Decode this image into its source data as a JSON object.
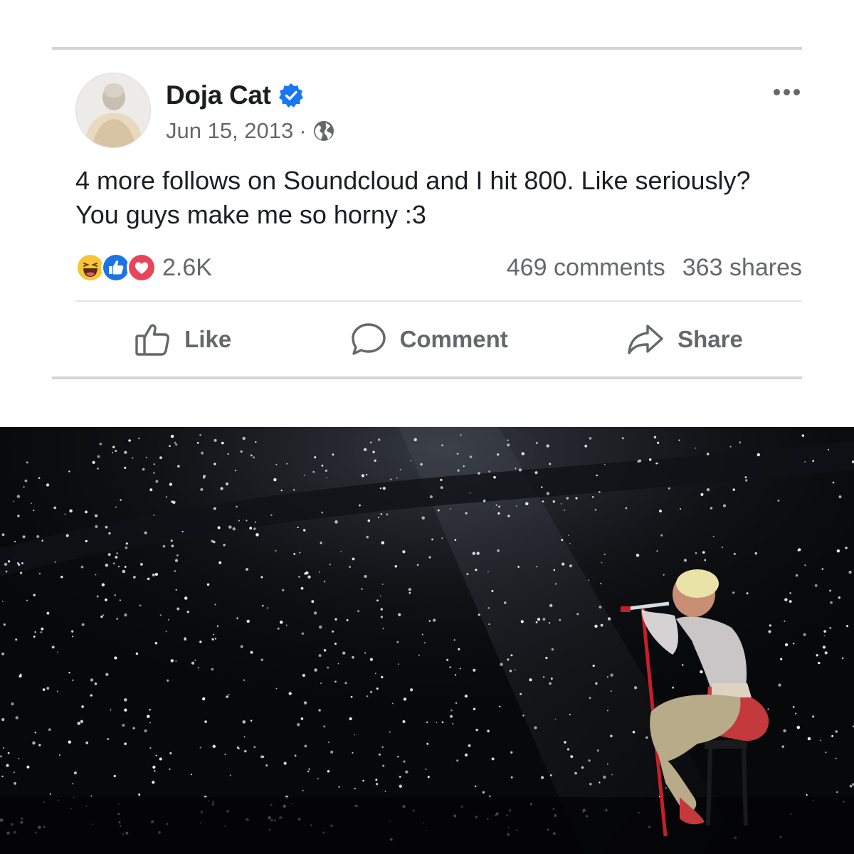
{
  "post": {
    "author": "Doja Cat",
    "date": "Jun 15, 2013",
    "separator": "·",
    "text": "4 more follows on Soundcloud and I hit 800. Like seriously? You guys make me so horny :3",
    "reaction_count": "2.6K",
    "comments": "469 comments",
    "shares": "363 shares",
    "reactions": [
      "haha-reaction-icon",
      "like-reaction-icon",
      "love-reaction-icon"
    ],
    "actions": {
      "like": "Like",
      "comment": "Comment",
      "share": "Share"
    }
  },
  "colors": {
    "verified_blue": "#1877f2",
    "text_primary": "#1c1e21",
    "text_secondary": "#65676b",
    "haha_yellow": "#f7c535",
    "like_blue": "#1b74e4",
    "love_red": "#e9455a"
  }
}
